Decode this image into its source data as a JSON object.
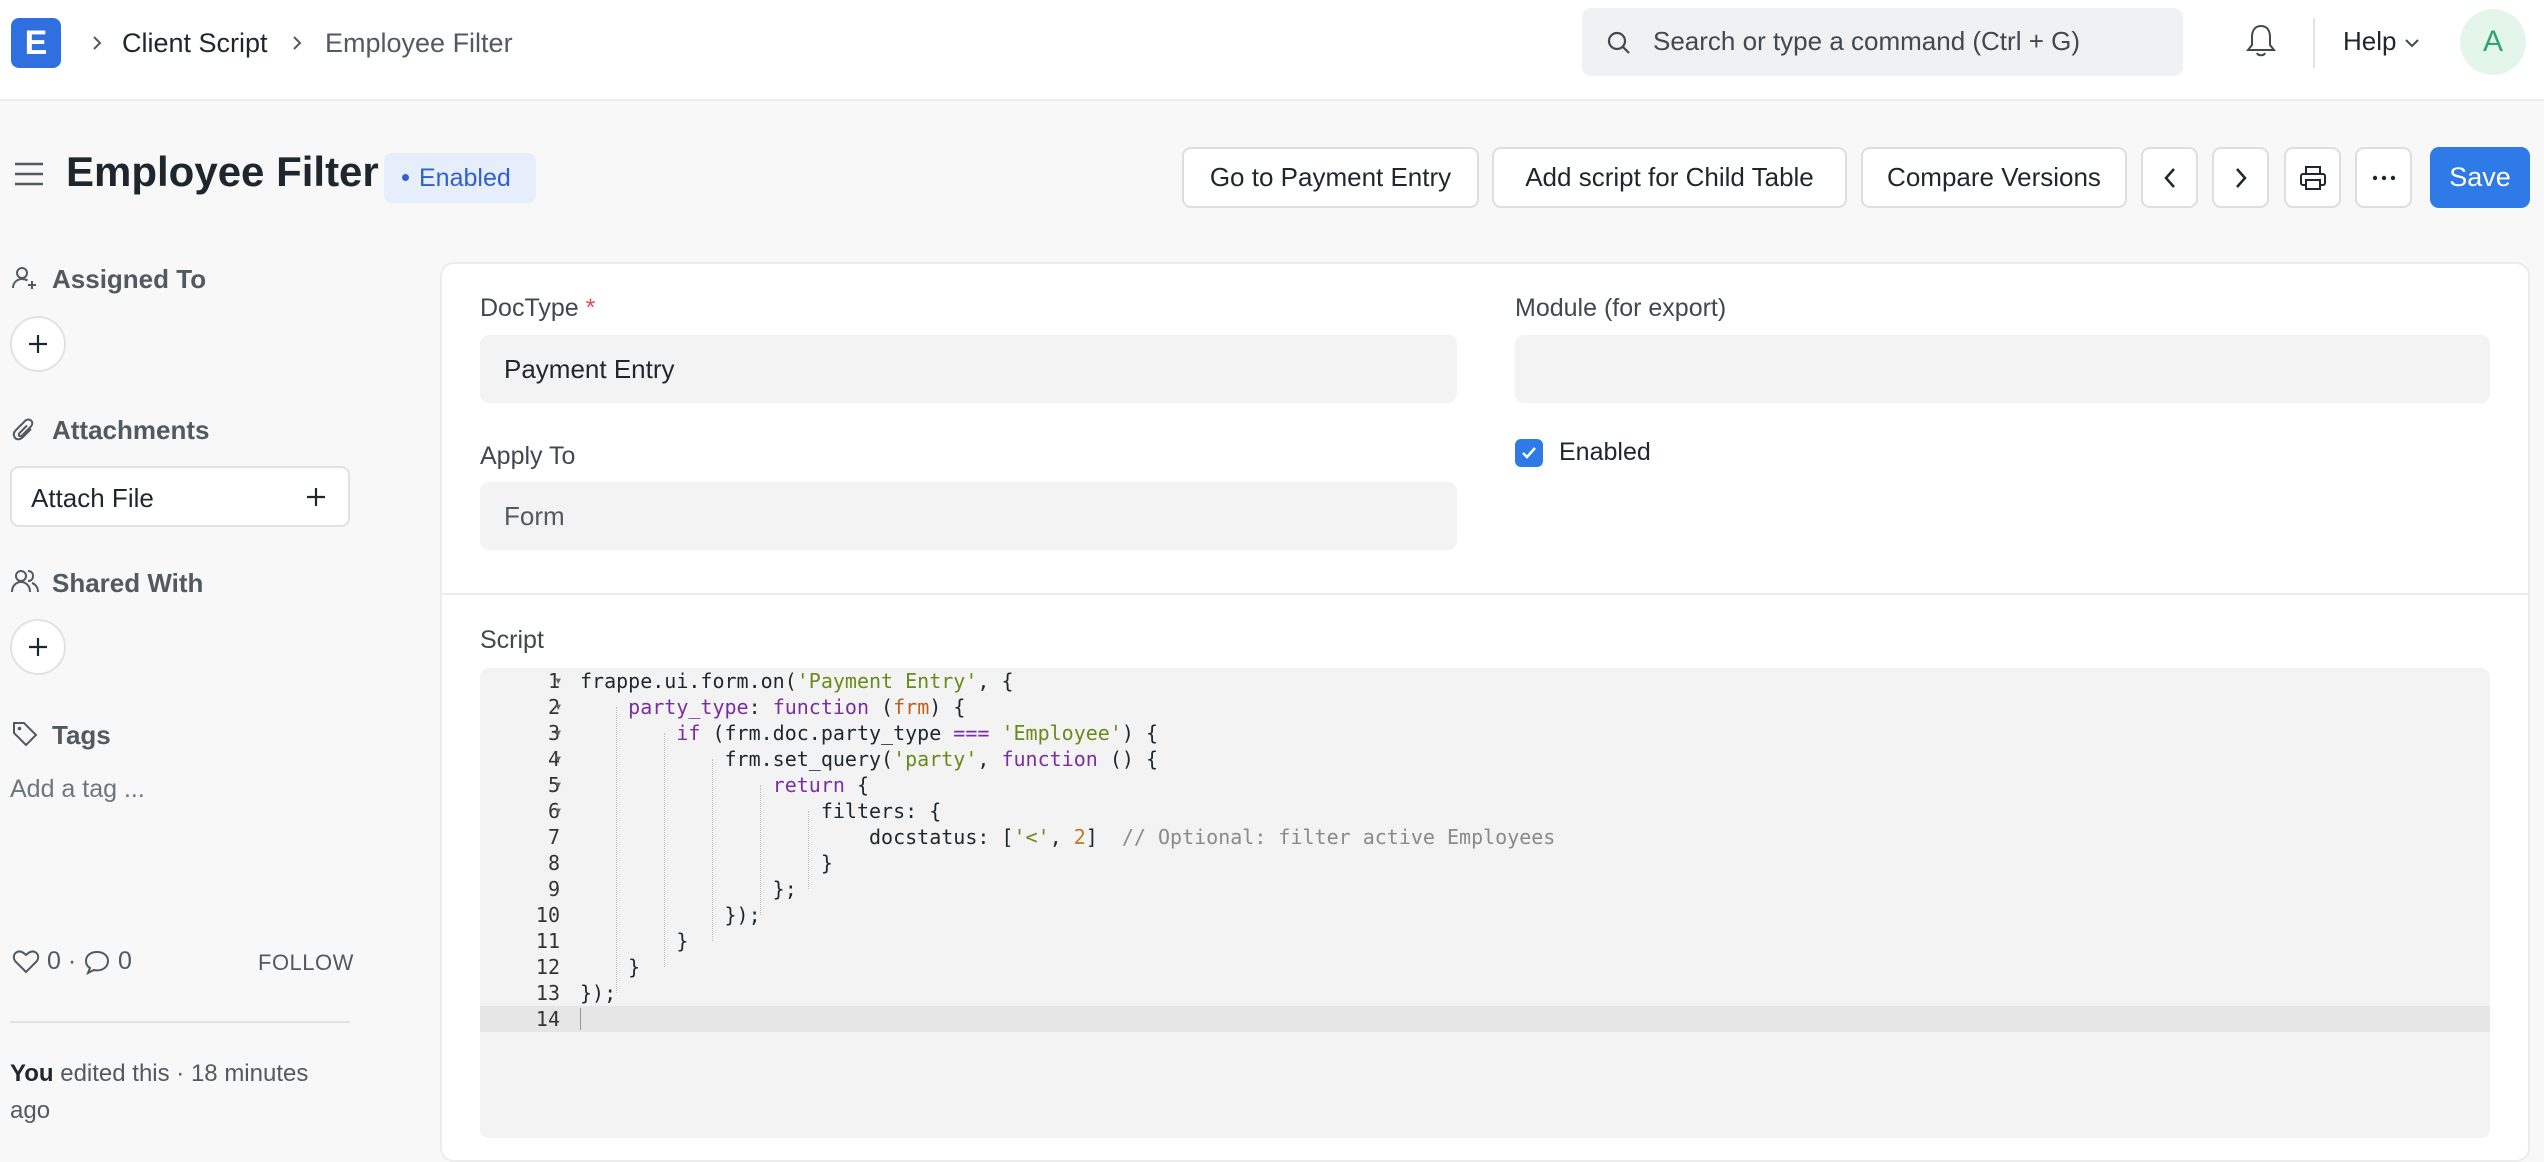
{
  "navbar": {
    "logo_letter": "E",
    "breadcrumbs": [
      "Client Script",
      "Employee Filter"
    ],
    "search_placeholder": "Search or type a command (Ctrl + G)",
    "help_label": "Help",
    "avatar_initial": "A"
  },
  "page": {
    "title": "Employee Filter",
    "status": "Enabled",
    "actions": {
      "go_to": "Go to Payment Entry",
      "add_child": "Add script for Child Table",
      "compare": "Compare Versions",
      "save": "Save"
    }
  },
  "sidebar": {
    "assigned_to": "Assigned To",
    "attachments": "Attachments",
    "attach_file": "Attach File",
    "shared_with": "Shared With",
    "tags": "Tags",
    "add_tag": "Add a tag ...",
    "likes": "0",
    "comments": "0",
    "follow": "FOLLOW",
    "activity_user": "You",
    "activity_text": " edited this · 18 minutes ago"
  },
  "form": {
    "doctype_label": "DocType",
    "doctype_value": "Payment Entry",
    "module_label": "Module (for export)",
    "module_value": "",
    "apply_to_label": "Apply To",
    "apply_to_value": "Form",
    "enabled_label": "Enabled",
    "enabled_checked": true,
    "script_label": "Script"
  },
  "script_lines": [
    "frappe.ui.form.on('Payment Entry', {",
    "    party_type: function (frm) {",
    "        if (frm.doc.party_type === 'Employee') {",
    "            frm.set_query('party', function () {",
    "                return {",
    "                    filters: {",
    "                        docstatus: ['<', 2]  // Optional: filter active Employees",
    "                    }",
    "                };",
    "            });",
    "        }",
    "    }",
    "});",
    ""
  ],
  "colors": {
    "primary": "#2e7ae6",
    "logo": "#2f6fe0",
    "status_bg": "#e6eefc",
    "required": "#e24c4c"
  }
}
